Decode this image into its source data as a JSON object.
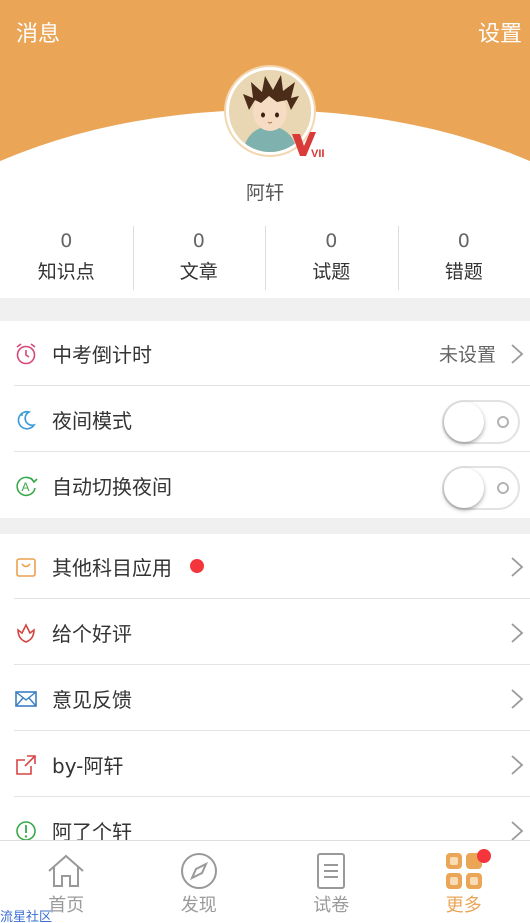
{
  "header": {
    "left_label": "消息",
    "right_label": "设置",
    "color": "#eaa557"
  },
  "profile": {
    "username": "阿轩",
    "badge": "VIP"
  },
  "stats": [
    {
      "value": "0",
      "label": "知识点"
    },
    {
      "value": "0",
      "label": "文章"
    },
    {
      "value": "0",
      "label": "试题"
    },
    {
      "value": "0",
      "label": "错题"
    }
  ],
  "settings": {
    "countdown": {
      "label": "中考倒计时",
      "value": "未设置",
      "icon": "alarm-clock-icon"
    },
    "night_mode": {
      "label": "夜间模式",
      "on": false,
      "icon": "moon-icon"
    },
    "auto_night": {
      "label": "自动切换夜间",
      "on": false,
      "icon": "auto-switch-icon"
    }
  },
  "menu": [
    {
      "label": "其他科目应用",
      "icon": "bag-icon",
      "badge_dot": true
    },
    {
      "label": "给个好评",
      "icon": "flower-icon"
    },
    {
      "label": "意见反馈",
      "icon": "mail-icon"
    },
    {
      "label": "by-阿轩",
      "icon": "share-icon"
    },
    {
      "label": "阿了个轩",
      "icon": "info-icon"
    }
  ],
  "tabs": [
    {
      "label": "首页",
      "icon": "home-icon",
      "active": false
    },
    {
      "label": "发现",
      "icon": "compass-icon",
      "active": false
    },
    {
      "label": "试卷",
      "icon": "paper-icon",
      "active": false
    },
    {
      "label": "更多",
      "icon": "grid-icon",
      "active": true
    }
  ],
  "watermark": "流星社区"
}
